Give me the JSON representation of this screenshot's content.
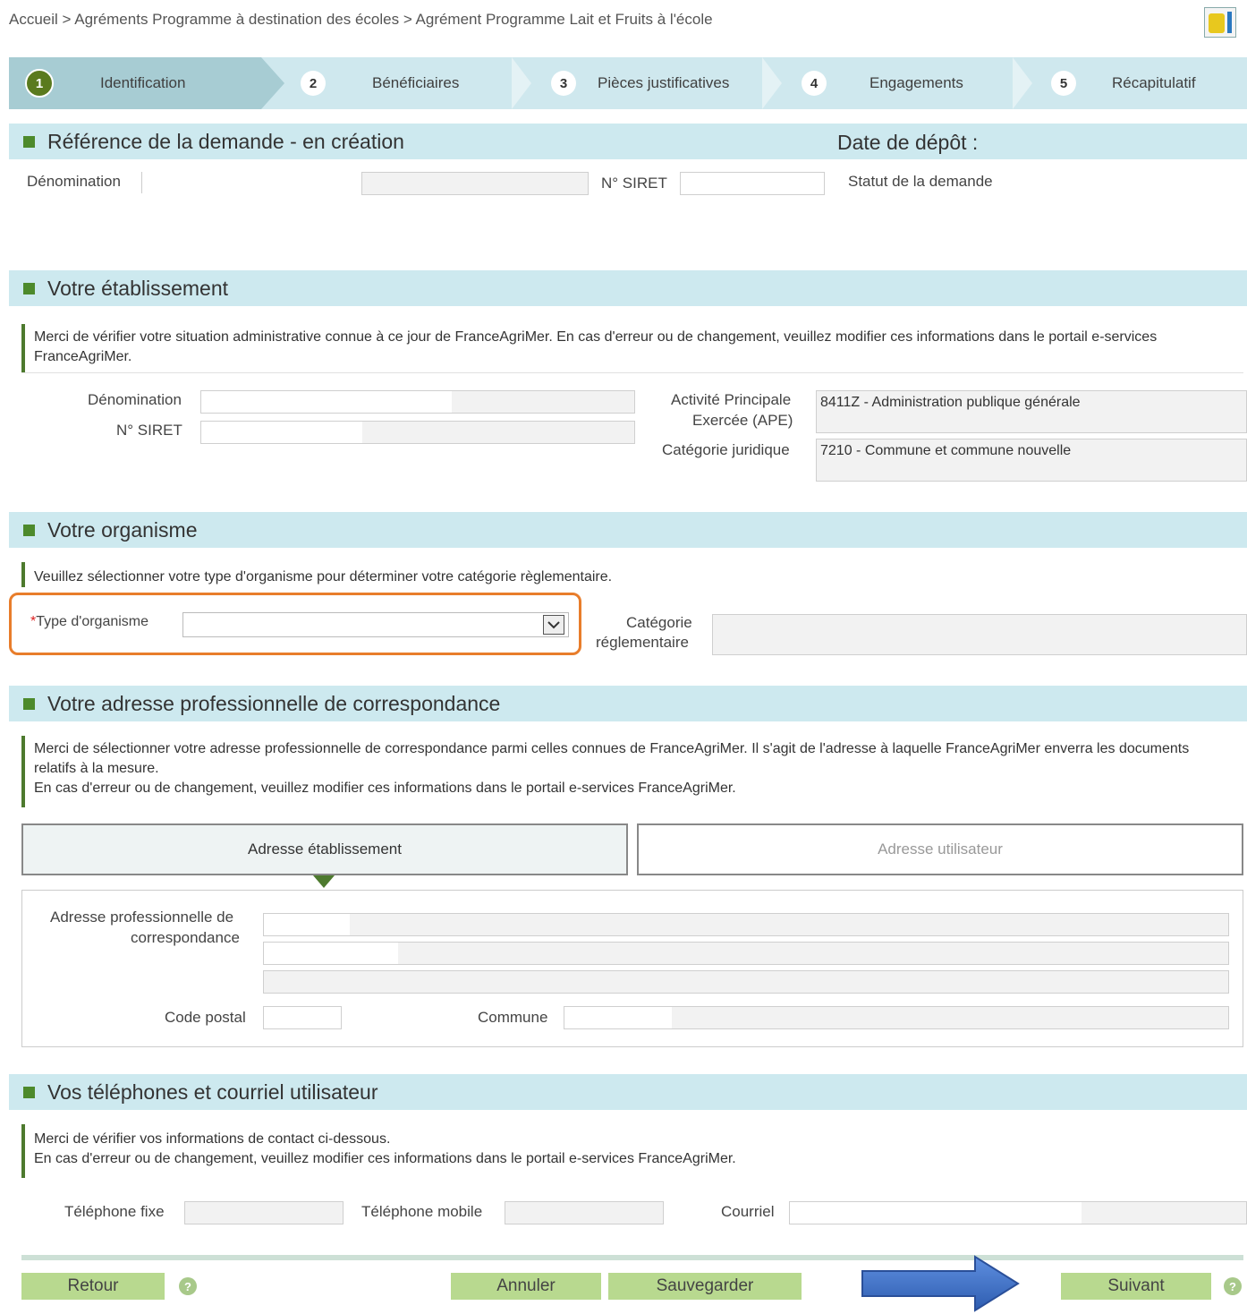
{
  "breadcrumb": {
    "text": "Accueil > Agréments Programme à destination des écoles > Agrément Programme Lait et Fruits à l'école"
  },
  "wizard": {
    "steps": [
      {
        "num": "1",
        "label": "Identification"
      },
      {
        "num": "2",
        "label": "Bénéficiaires"
      },
      {
        "num": "3",
        "label": "Pièces justificatives"
      },
      {
        "num": "4",
        "label": "Engagements"
      },
      {
        "num": "5",
        "label": "Récapitulatif"
      }
    ]
  },
  "reference": {
    "title": "Référence de la demande - en création",
    "date_label": "Date de dépôt :",
    "denomination_label": "Dénomination",
    "siret_label": "N° SIRET",
    "statut_label": "Statut de la demande"
  },
  "etablissement": {
    "title": "Votre établissement",
    "info": "Merci de vérifier votre situation administrative connue à ce jour de FranceAgriMer. En cas d'erreur ou de changement, veuillez modifier ces informations dans le portail e-services FranceAgriMer.",
    "denomination_label": "Dénomination",
    "siret_label": "N° SIRET",
    "ape_label_1": "Activité Principale",
    "ape_label_2": "Exercée (APE)",
    "ape_value": "8411Z - Administration publique générale",
    "cat_label": "Catégorie juridique",
    "cat_value": "7210 - Commune et commune nouvelle"
  },
  "organisme": {
    "title": "Votre organisme",
    "info": "Veuillez sélectionner votre type d'organisme pour déterminer votre catégorie règlementaire.",
    "required_mark": "*",
    "type_label": "Type d'organisme",
    "type_value": "",
    "cat_label_1": "Catégorie",
    "cat_label_2": "réglementaire"
  },
  "adresse": {
    "title": "Votre adresse professionnelle de correspondance",
    "info_1": "Merci de sélectionner votre adresse professionnelle de correspondance parmi celles connues de FranceAgriMer. Il s'agit de l'adresse à laquelle FranceAgriMer enverra les documents relatifs à la mesure.",
    "info_2": "En cas d'erreur ou de changement, veuillez modifier ces informations dans le portail e-services FranceAgriMer.",
    "tab_etab": "Adresse établissement",
    "tab_user": "Adresse utilisateur",
    "addr_label_1": "Adresse professionnelle de",
    "addr_label_2": "correspondance",
    "cp_label": "Code postal",
    "commune_label": "Commune"
  },
  "contact": {
    "title": "Vos téléphones et courriel utilisateur",
    "info_1": "Merci de vérifier vos informations de contact ci-dessous.",
    "info_2": "En cas d'erreur ou de changement, veuillez modifier ces informations dans le portail e-services FranceAgriMer.",
    "tel_fixe_label": "Téléphone fixe",
    "tel_mobile_label": "Téléphone mobile",
    "courriel_label": "Courriel"
  },
  "footer": {
    "retour": "Retour",
    "annuler": "Annuler",
    "sauvegarder": "Sauvegarder",
    "suivant": "Suivant",
    "help": "?"
  },
  "colors": {
    "accent_green": "#4d8a2c",
    "section_bg": "#cde9ef",
    "button_bg": "#b8d98f",
    "highlight_orange": "#e87d2b",
    "arrow_blue": "#3a6fc0"
  }
}
